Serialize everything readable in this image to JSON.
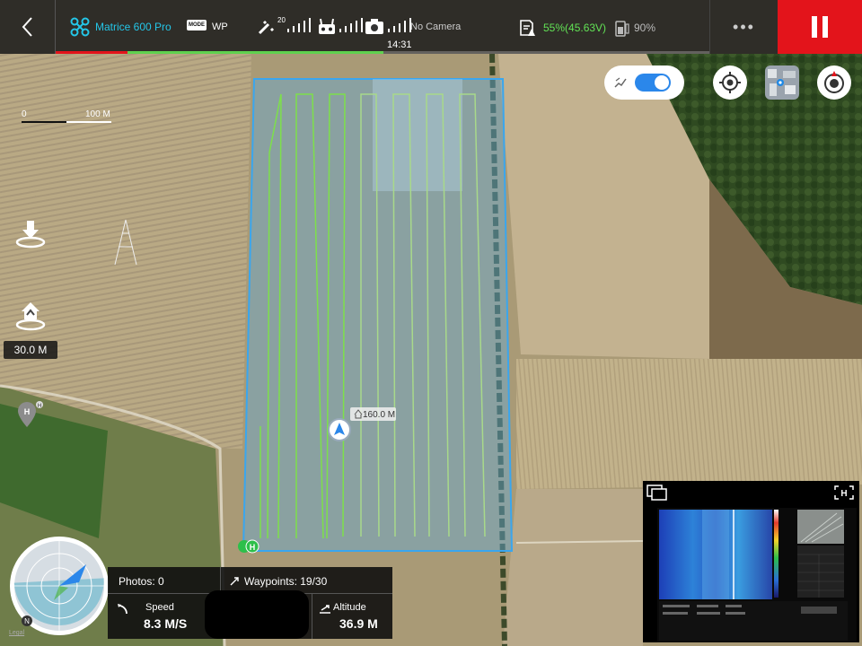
{
  "topbar": {
    "aircraft_name": "Matrice 600 Pro",
    "mode_badge": "MODE",
    "mode_value": "WP",
    "gps_satellites": "20",
    "camera_status": "No Camera",
    "flight_time": "14:31",
    "battery": "55%(45.63V)",
    "rc_battery": "90%",
    "mission_progress": 0.44,
    "colors": {
      "accent": "#24c6e8",
      "battery": "#62e255",
      "stop": "#e3141b"
    }
  },
  "map": {
    "scale_start": "0",
    "scale_end": "100 M",
    "home_distance": "160.0 M",
    "home_marker": "H",
    "preview_home_label": "H",
    "legal_link": "Legal"
  },
  "left_controls": {
    "takeoff_altitude": "30.0 M"
  },
  "telemetry": {
    "photos": "Photos: 0",
    "waypoints": "Waypoints: 19/30",
    "speed_label": "Speed",
    "speed_value": "8.3 M/S",
    "altitude_label": "Altitude",
    "altitude_value": "36.9 M"
  },
  "compass": {
    "north_label": "N"
  },
  "icons": [
    "back-icon",
    "drone-icon",
    "gps-icon",
    "signal-bars-icon",
    "remote-controller-icon",
    "camera-icon",
    "battery-icon",
    "rc-battery-icon",
    "more-icon",
    "pause-icon",
    "route-icon",
    "locate-icon",
    "map-type-icon",
    "compass-icon",
    "takeoff-icon",
    "return-home-icon",
    "home-pin-icon",
    "swap-view-icon",
    "fullscreen-icon"
  ]
}
